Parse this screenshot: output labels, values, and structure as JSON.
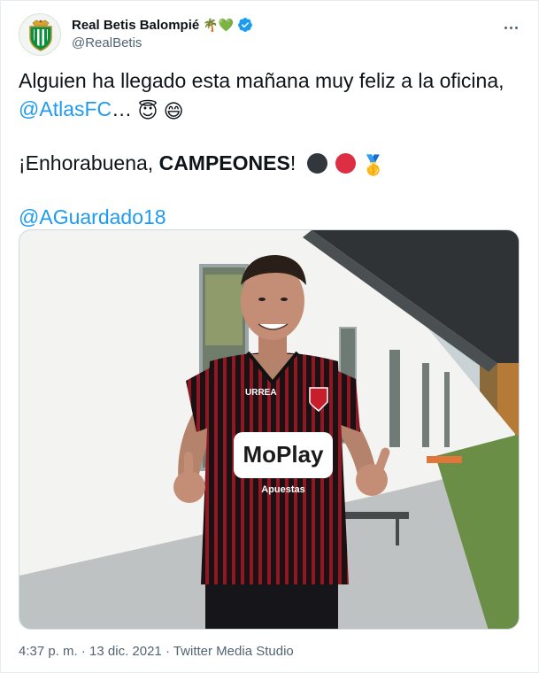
{
  "account": {
    "display_name": "Real Betis Balompié",
    "name_emojis": "🌴💚",
    "handle": "@RealBetis",
    "verified": true
  },
  "tweet": {
    "line1": "Alguien ha llegado esta mañana muy feliz a la oficina,",
    "mention_atlas": "@AtlasFC",
    "ellipsis": "…",
    "emojis_line2": "😇 😄",
    "line3_prefix": "¡Enhorabuena, ",
    "line3_bold": "CAMPEONES",
    "line3_suffix": "!",
    "circle_colors": [
      "#31373d",
      "#dd2e44"
    ],
    "medal_emoji": "🥇",
    "mention_player": "@AGuardado18"
  },
  "media": {
    "jersey_brand": "MoPlay",
    "jersey_sub": "Apuestas",
    "sleeve_brand": "URREA"
  },
  "footer": {
    "time": "4:37 p. m.",
    "sep1": " · ",
    "date": "13 dic. 2021",
    "sep2": " · ",
    "source": "Twitter Media Studio"
  },
  "colors": {
    "link": "#1d9bf0",
    "verified": "#1d9bf0",
    "secondary_text": "#536471"
  }
}
